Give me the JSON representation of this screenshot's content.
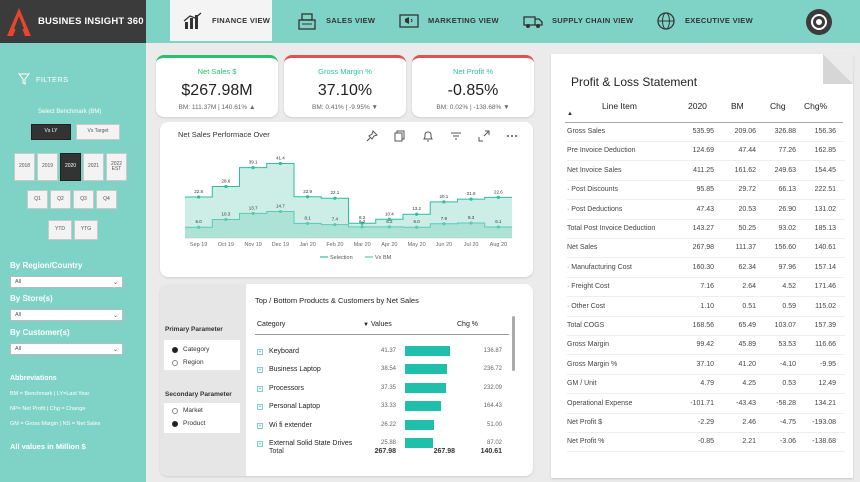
{
  "app": {
    "title": "BUSINES INSIGHT 360",
    "accent": "#7fd3c6",
    "dark": "#3b3b3b"
  },
  "nav": {
    "tabs": [
      {
        "label": "FINANCE VIEW",
        "icon": "bar-chart-icon",
        "active": true
      },
      {
        "label": "SALES VIEW",
        "icon": "cash-register-icon",
        "active": false
      },
      {
        "label": "MARKETING VIEW",
        "icon": "megaphone-icon",
        "active": false
      },
      {
        "label": "SUPPLY CHAIN VIEW",
        "icon": "delivery-truck-icon",
        "active": false
      },
      {
        "label": "EXECUTIVE VIEW",
        "icon": "globe-icon",
        "active": false
      }
    ]
  },
  "filters": {
    "heading": "FILTERS",
    "benchmark_label": "Select Benchmark (BM)",
    "benchmark_options": [
      "Vs LY",
      "Vs Target"
    ],
    "benchmark_selected": "Vs LY",
    "years": [
      "2018",
      "2019",
      "2020",
      "2021",
      "2022 EST"
    ],
    "year_selected": "2020",
    "quarters": [
      "Q1",
      "Q2",
      "Q3",
      "Q4"
    ],
    "ytd_options": [
      "YTD",
      "YTG"
    ],
    "region_label": "By Region/Country",
    "region_value": "All",
    "store_label": "By Store(s)",
    "store_value": "All",
    "customer_label": "By Customer(s)",
    "customer_value": "All",
    "abbr_title": "Abbreviations",
    "abbr_lines": [
      "BM = Benchmark | LY=Last Year",
      "NP= Net Profit | Chg = Change",
      "GM = Gross Margin | NS = Net Sales"
    ],
    "units_note": "All values in Million $"
  },
  "kpis": [
    {
      "title": "Net Sales $",
      "value": "$267.98M",
      "sub": "BM: 111.37M | 140.61% ▲",
      "color": "#2bbf6f"
    },
    {
      "title": "Gross Margin %",
      "value": "37.10%",
      "sub": "BM: 0.41% | -9.95% ▼",
      "color": "#e05252"
    },
    {
      "title": "Net Profit %",
      "value": "-0.85%",
      "sub": "BM: 0.02% | -138.68% ▼",
      "color": "#e05252"
    }
  ],
  "chart": {
    "title": "Net Sales Performace Over",
    "header_icons": [
      "pin-icon",
      "copy-icon",
      "bell-icon",
      "filter-icon",
      "expand-icon",
      "more-icon"
    ]
  },
  "chart_data": {
    "type": "area",
    "title": "Net Sales Performace Over",
    "x": [
      "Sep 19",
      "Oct 19",
      "Nov 19",
      "Dec 19",
      "Jan 20",
      "Feb 20",
      "Mar 20",
      "Apr 20",
      "May 20",
      "Jun 20",
      "Jul 20",
      "Aug 20"
    ],
    "series": [
      {
        "name": "Selection",
        "values": [
          22.8,
          28.6,
          39.1,
          41.4,
          22.9,
          22.1,
          8.2,
          10.4,
          13.2,
          20.1,
          21.6,
          22.6
        ],
        "color": "#2bbf9f"
      },
      {
        "name": "Vs BM",
        "values": [
          6.0,
          10.3,
          13.7,
          14.7,
          8.1,
          7.4,
          6.2,
          6.2,
          6.0,
          7.9,
          8.3,
          6.1
        ],
        "color": "#5cc9b4"
      }
    ],
    "legend_placement": "bottom",
    "grid": false
  },
  "products": {
    "title": "Top / Bottom Products & Customers by Net Sales",
    "primary_title": "Primary Parameter",
    "primary_options": [
      "Category",
      "Region"
    ],
    "primary_selected": "Category",
    "secondary_title": "Secondary Parameter",
    "secondary_options": [
      "Market",
      "Product"
    ],
    "secondary_selected": "Product",
    "headers": {
      "category": "Category",
      "values": "Values",
      "chg": "Chg %"
    },
    "rows": [
      {
        "name": "Keyboard",
        "value": "41.37",
        "value_num": 41.37,
        "chg": "136.87"
      },
      {
        "name": "Business Laptop",
        "value": "38.54",
        "value_num": 38.54,
        "chg": "236.72"
      },
      {
        "name": "Processors",
        "value": "37.35",
        "value_num": 37.35,
        "chg": "232.09"
      },
      {
        "name": "Personal Laptop",
        "value": "33.33",
        "value_num": 33.33,
        "chg": "164.43"
      },
      {
        "name": "Wi fi extender",
        "value": "26.22",
        "value_num": 26.22,
        "chg": "51.00"
      },
      {
        "name": "External Solid State Drives",
        "value": "25.88",
        "value_num": 25.88,
        "chg": "87.02"
      }
    ],
    "total": {
      "label": "Total",
      "value": "267.98",
      "bar_value": "267.98",
      "chg": "140.61"
    }
  },
  "pl": {
    "title": "Profit & Loss Statement",
    "headers": [
      "Line Item",
      "2020",
      "BM",
      "Chg",
      "Chg%"
    ],
    "rows": [
      [
        "Gross Sales",
        "535.95",
        "209.06",
        "326.88",
        "156.36"
      ],
      [
        "Pre Invoice Deduction",
        "124.69",
        "47.44",
        "77.26",
        "162.85"
      ],
      [
        "Net Invoice Sales",
        "411.25",
        "161.62",
        "249.63",
        "154.45"
      ],
      [
        "· Post Discounts",
        "95.85",
        "29.72",
        "66.13",
        "222.51"
      ],
      [
        "· Post Deductions",
        "47.43",
        "20.53",
        "26.90",
        "131.02"
      ],
      [
        "Total Post Invoice Deduction",
        "143.27",
        "50.25",
        "93.02",
        "185.13"
      ],
      [
        "Net Sales",
        "267.98",
        "111.37",
        "156.60",
        "140.61"
      ],
      [
        "· Manufacturing Cost",
        "160.30",
        "62.34",
        "97.96",
        "157.14"
      ],
      [
        "· Freight Cost",
        "7.16",
        "2.64",
        "4.52",
        "171.46"
      ],
      [
        "· Other Cost",
        "1.10",
        "0.51",
        "0.59",
        "115.02"
      ],
      [
        "Total COGS",
        "168.56",
        "65.49",
        "103.07",
        "157.39"
      ],
      [
        "Gross Margin",
        "99.42",
        "45.89",
        "53.53",
        "116.66"
      ],
      [
        "Gross Margin %",
        "37.10",
        "41.20",
        "-4.10",
        "-9.95"
      ],
      [
        "GM / Unit",
        "4.79",
        "4.25",
        "0.53",
        "12.49"
      ],
      [
        "Operational Expense",
        "-101.71",
        "-43.43",
        "-58.28",
        "134.21"
      ],
      [
        "Net Profit $",
        "-2.29",
        "2.46",
        "-4.75",
        "-193.08"
      ],
      [
        "Net Profit %",
        "-0.85",
        "2.21",
        "-3.06",
        "-138.68"
      ]
    ]
  }
}
